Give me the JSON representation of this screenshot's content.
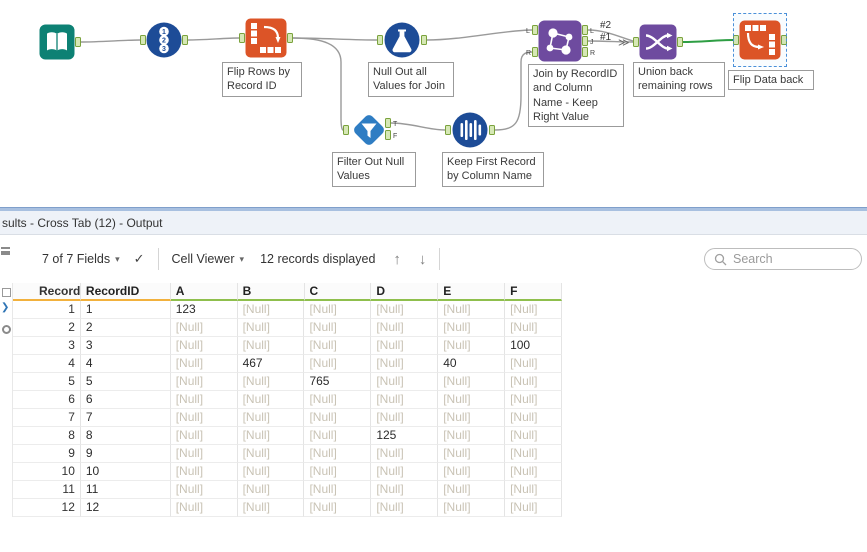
{
  "canvas": {
    "tools": [
      {
        "id": "input-data",
        "label": ""
      },
      {
        "id": "record-id",
        "label": ""
      },
      {
        "id": "transpose",
        "label": "Flip Rows by\nRecord ID"
      },
      {
        "id": "formula",
        "label": "Null Out all\nValues for Join"
      },
      {
        "id": "filter",
        "label": "Filter Out Null\nValues"
      },
      {
        "id": "unique",
        "label": "Keep First Record\nby Column Name"
      },
      {
        "id": "join",
        "label": "Join by RecordID\nand Column\nName - Keep\nRight Value"
      },
      {
        "id": "union",
        "label": "Union back\nremaining rows"
      },
      {
        "id": "cross-tab",
        "label": "Flip Data back"
      }
    ],
    "record_id_digits": [
      "1",
      "2",
      "3"
    ],
    "anchor_letters": {
      "filter_true": "T",
      "filter_false": "F",
      "join_in_left": "L",
      "join_in_right": "R",
      "join_out_left": "L",
      "join_out_join": "J",
      "join_out_right": "R"
    },
    "wire_labels": {
      "second": "#2",
      "first": "#1",
      "multi_marker": "≫"
    },
    "colors": {
      "selected_wire": "#2e9e44",
      "wire": "#9a9a9a",
      "anchor_fill": "#d6e8b5",
      "anchor_border": "#7aa23c"
    }
  },
  "results": {
    "title": "sults - Cross Tab (12) - Output",
    "toolbar": {
      "fields": "7 of 7 Fields",
      "cell_viewer": "Cell Viewer",
      "records": "12 records displayed",
      "search_placeholder": "Search"
    },
    "table": {
      "null_text": "[Null]",
      "null_text_color": "#c9c3b5",
      "columns": [
        {
          "label": "Record",
          "type_color": "#f2b13d"
        },
        {
          "label": "RecordID",
          "type_color": "#f2b13d"
        },
        {
          "label": "A",
          "type_color": "#8fbf4d"
        },
        {
          "label": "B",
          "type_color": "#8fbf4d"
        },
        {
          "label": "C",
          "type_color": "#8fbf4d"
        },
        {
          "label": "D",
          "type_color": "#8fbf4d"
        },
        {
          "label": "E",
          "type_color": "#8fbf4d"
        },
        {
          "label": "F",
          "type_color": "#8fbf4d"
        }
      ],
      "rows": [
        [
          "1",
          "1",
          "123",
          "[Null]",
          "[Null]",
          "[Null]",
          "[Null]",
          "[Null]"
        ],
        [
          "2",
          "2",
          "[Null]",
          "[Null]",
          "[Null]",
          "[Null]",
          "[Null]",
          "[Null]"
        ],
        [
          "3",
          "3",
          "[Null]",
          "[Null]",
          "[Null]",
          "[Null]",
          "[Null]",
          "100"
        ],
        [
          "4",
          "4",
          "[Null]",
          "467",
          "[Null]",
          "[Null]",
          "40",
          "[Null]"
        ],
        [
          "5",
          "5",
          "[Null]",
          "[Null]",
          "765",
          "[Null]",
          "[Null]",
          "[Null]"
        ],
        [
          "6",
          "6",
          "[Null]",
          "[Null]",
          "[Null]",
          "[Null]",
          "[Null]",
          "[Null]"
        ],
        [
          "7",
          "7",
          "[Null]",
          "[Null]",
          "[Null]",
          "[Null]",
          "[Null]",
          "[Null]"
        ],
        [
          "8",
          "8",
          "[Null]",
          "[Null]",
          "[Null]",
          "125",
          "[Null]",
          "[Null]"
        ],
        [
          "9",
          "9",
          "[Null]",
          "[Null]",
          "[Null]",
          "[Null]",
          "[Null]",
          "[Null]"
        ],
        [
          "10",
          "10",
          "[Null]",
          "[Null]",
          "[Null]",
          "[Null]",
          "[Null]",
          "[Null]"
        ],
        [
          "11",
          "11",
          "[Null]",
          "[Null]",
          "[Null]",
          "[Null]",
          "[Null]",
          "[Null]"
        ],
        [
          "12",
          "12",
          "[Null]",
          "[Null]",
          "[Null]",
          "[Null]",
          "[Null]",
          "[Null]"
        ]
      ]
    }
  }
}
